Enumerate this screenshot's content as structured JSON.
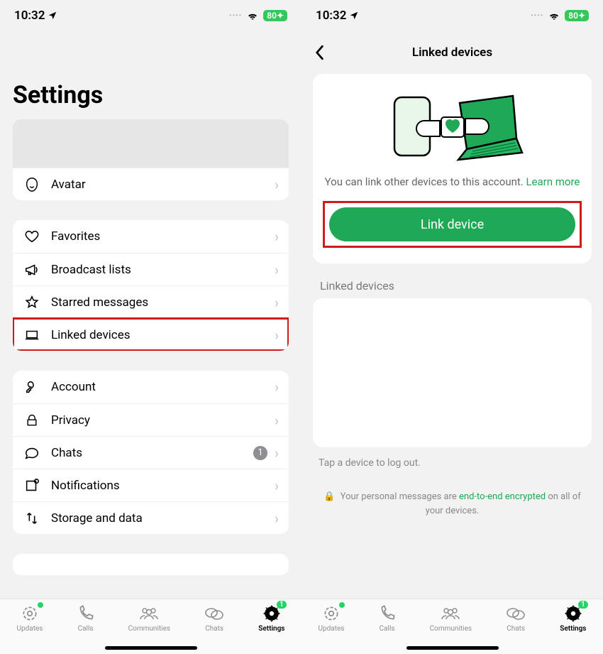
{
  "status": {
    "time": "10:32",
    "battery": "80"
  },
  "settings": {
    "title": "Settings",
    "avatar": "Avatar",
    "group2": {
      "favorites": "Favorites",
      "broadcast": "Broadcast lists",
      "starred": "Starred messages",
      "linked": "Linked devices"
    },
    "group3": {
      "account": "Account",
      "privacy": "Privacy",
      "chats": "Chats",
      "chats_badge": "1",
      "notifications": "Notifications",
      "storage": "Storage and data"
    }
  },
  "linked_page": {
    "title": "Linked devices",
    "hero_text": "You can link other devices to this account. ",
    "learn_more": "Learn more",
    "link_button": "Link device",
    "section": "Linked devices",
    "tap_hint": "Tap a device to log out.",
    "footer_pre": "Your personal messages are ",
    "footer_enc": "end-to-end encrypted",
    "footer_post": " on all of your devices."
  },
  "tabs": {
    "updates": "Updates",
    "calls": "Calls",
    "communities": "Communities",
    "chats": "Chats",
    "settings": "Settings",
    "settings_badge": "1"
  }
}
